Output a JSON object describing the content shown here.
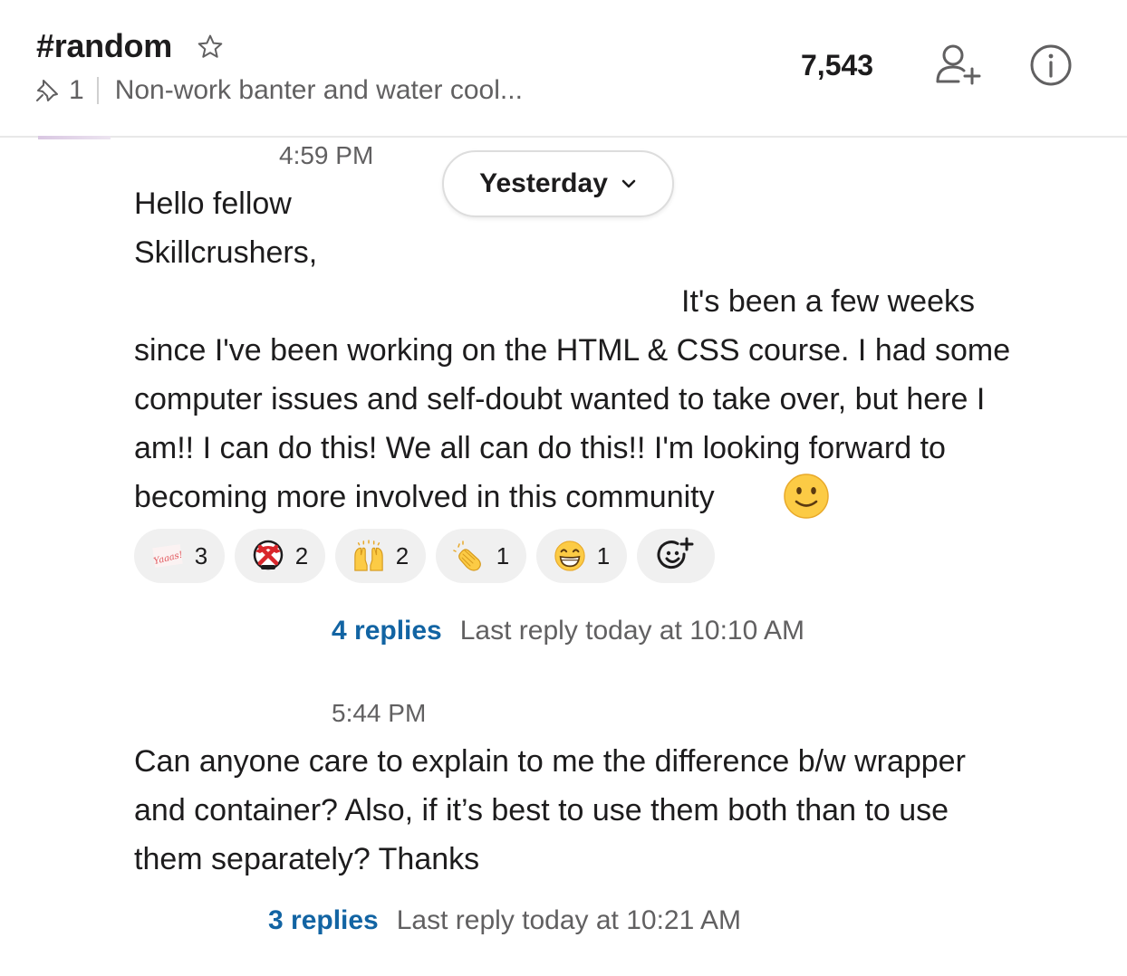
{
  "header": {
    "channel_name": "#random",
    "pinned_count": "1",
    "topic": "Non-work banter and water cool...",
    "member_count": "7,543"
  },
  "date_divider": {
    "label": "Yesterday"
  },
  "messages": [
    {
      "timestamp": "4:59 PM",
      "text_line1": "Hello fellow",
      "text_line2": "Skillcrushers,",
      "text_line3": "It's been a few weeks",
      "text_line4": "since I've been working on the HTML & CSS course. I had some",
      "text_line5": "computer issues and self-doubt wanted to take over, but here I",
      "text_line6": "am!! I can do this! We all can do this!! I'm looking forward to",
      "text_line7": "becoming more involved in this community",
      "reactions": [
        {
          "emoji": "yaaas-emoji",
          "count": "3"
        },
        {
          "emoji": "x-emoji",
          "count": "2"
        },
        {
          "emoji": "raised-hands-emoji",
          "count": "2"
        },
        {
          "emoji": "clap-emoji",
          "count": "1"
        },
        {
          "emoji": "smile-emoji",
          "count": "1"
        }
      ],
      "reaction_custom_text": "Yaaas!",
      "replies": "4 replies",
      "last_reply": "Last reply today at 10:10 AM"
    },
    {
      "timestamp": "5:44 PM",
      "text_line1": "Can anyone care to explain to me the difference b/w wrapper",
      "text_line2": "and container? Also, if it’s best to use them both than to use",
      "text_line3": "them separately? Thanks",
      "replies": "3 replies",
      "last_reply": "Last reply today at 10:21 AM"
    }
  ],
  "colors": {
    "link": "#1264a3",
    "muted": "#616061",
    "text": "#1d1c1d",
    "reaction_bg": "#f0f0f0"
  }
}
